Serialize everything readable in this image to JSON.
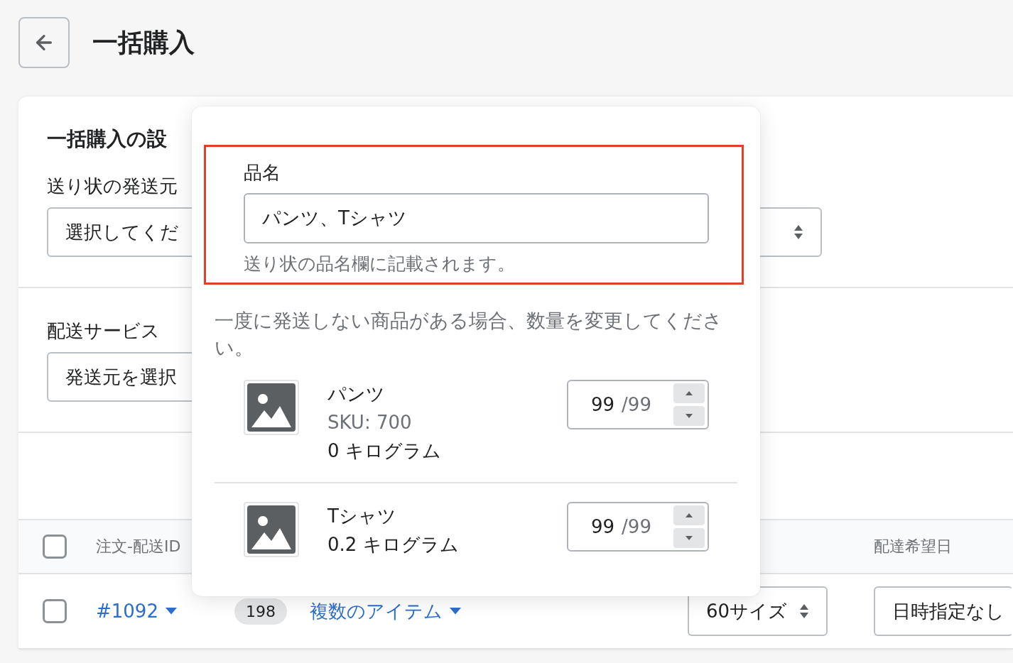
{
  "header": {
    "title": "一括購入"
  },
  "settings": {
    "title": "一括購入の設",
    "sender": {
      "label": "送り状の発送元",
      "value": "選択してくだ"
    },
    "service": {
      "label": "配送サービス",
      "value": "発送元を選択"
    }
  },
  "table": {
    "columns": [
      "注文-配送ID",
      "配達希望日"
    ],
    "header_checked": false,
    "rows": [
      {
        "checked": false,
        "order": "#1092",
        "count": "198",
        "items": "複数のアイテム",
        "size": "60サイズ",
        "delivery": "日時指定なし"
      }
    ]
  },
  "popover": {
    "name_field": {
      "label": "品名",
      "value": "パンツ、Tシャツ",
      "help": "送り状の品名欄に記載されます。",
      "highlighted": true
    },
    "note": "一度に発送しない商品がある場合、数量を変更してください。",
    "products": [
      {
        "name": "パンツ",
        "sku": "SKU: 700",
        "weight": "0 キログラム",
        "quantity": "99",
        "max": "/99"
      },
      {
        "name": "Tシャツ",
        "weight": "0.2 キログラム",
        "quantity": "99",
        "max": "/99"
      }
    ]
  }
}
